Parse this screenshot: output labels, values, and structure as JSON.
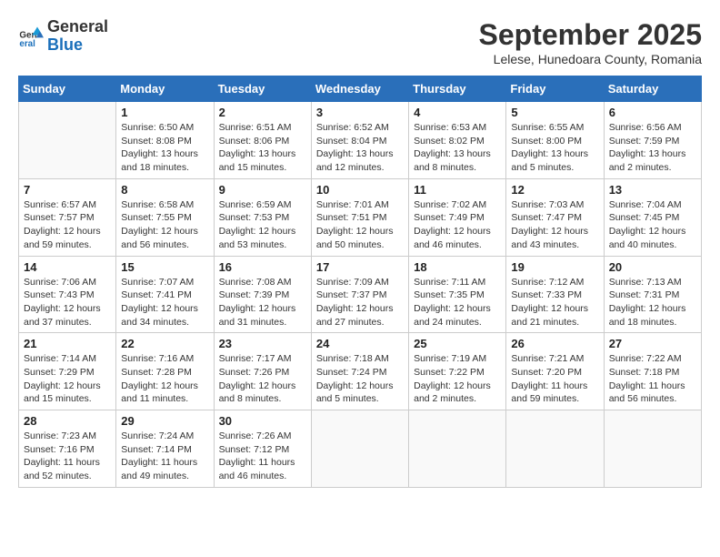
{
  "header": {
    "logo_general": "General",
    "logo_blue": "Blue",
    "month": "September 2025",
    "location": "Lelese, Hunedoara County, Romania"
  },
  "days_of_week": [
    "Sunday",
    "Monday",
    "Tuesday",
    "Wednesday",
    "Thursday",
    "Friday",
    "Saturday"
  ],
  "weeks": [
    [
      {
        "day": "",
        "info": ""
      },
      {
        "day": "1",
        "info": "Sunrise: 6:50 AM\nSunset: 8:08 PM\nDaylight: 13 hours\nand 18 minutes."
      },
      {
        "day": "2",
        "info": "Sunrise: 6:51 AM\nSunset: 8:06 PM\nDaylight: 13 hours\nand 15 minutes."
      },
      {
        "day": "3",
        "info": "Sunrise: 6:52 AM\nSunset: 8:04 PM\nDaylight: 13 hours\nand 12 minutes."
      },
      {
        "day": "4",
        "info": "Sunrise: 6:53 AM\nSunset: 8:02 PM\nDaylight: 13 hours\nand 8 minutes."
      },
      {
        "day": "5",
        "info": "Sunrise: 6:55 AM\nSunset: 8:00 PM\nDaylight: 13 hours\nand 5 minutes."
      },
      {
        "day": "6",
        "info": "Sunrise: 6:56 AM\nSunset: 7:59 PM\nDaylight: 13 hours\nand 2 minutes."
      }
    ],
    [
      {
        "day": "7",
        "info": "Sunrise: 6:57 AM\nSunset: 7:57 PM\nDaylight: 12 hours\nand 59 minutes."
      },
      {
        "day": "8",
        "info": "Sunrise: 6:58 AM\nSunset: 7:55 PM\nDaylight: 12 hours\nand 56 minutes."
      },
      {
        "day": "9",
        "info": "Sunrise: 6:59 AM\nSunset: 7:53 PM\nDaylight: 12 hours\nand 53 minutes."
      },
      {
        "day": "10",
        "info": "Sunrise: 7:01 AM\nSunset: 7:51 PM\nDaylight: 12 hours\nand 50 minutes."
      },
      {
        "day": "11",
        "info": "Sunrise: 7:02 AM\nSunset: 7:49 PM\nDaylight: 12 hours\nand 46 minutes."
      },
      {
        "day": "12",
        "info": "Sunrise: 7:03 AM\nSunset: 7:47 PM\nDaylight: 12 hours\nand 43 minutes."
      },
      {
        "day": "13",
        "info": "Sunrise: 7:04 AM\nSunset: 7:45 PM\nDaylight: 12 hours\nand 40 minutes."
      }
    ],
    [
      {
        "day": "14",
        "info": "Sunrise: 7:06 AM\nSunset: 7:43 PM\nDaylight: 12 hours\nand 37 minutes."
      },
      {
        "day": "15",
        "info": "Sunrise: 7:07 AM\nSunset: 7:41 PM\nDaylight: 12 hours\nand 34 minutes."
      },
      {
        "day": "16",
        "info": "Sunrise: 7:08 AM\nSunset: 7:39 PM\nDaylight: 12 hours\nand 31 minutes."
      },
      {
        "day": "17",
        "info": "Sunrise: 7:09 AM\nSunset: 7:37 PM\nDaylight: 12 hours\nand 27 minutes."
      },
      {
        "day": "18",
        "info": "Sunrise: 7:11 AM\nSunset: 7:35 PM\nDaylight: 12 hours\nand 24 minutes."
      },
      {
        "day": "19",
        "info": "Sunrise: 7:12 AM\nSunset: 7:33 PM\nDaylight: 12 hours\nand 21 minutes."
      },
      {
        "day": "20",
        "info": "Sunrise: 7:13 AM\nSunset: 7:31 PM\nDaylight: 12 hours\nand 18 minutes."
      }
    ],
    [
      {
        "day": "21",
        "info": "Sunrise: 7:14 AM\nSunset: 7:29 PM\nDaylight: 12 hours\nand 15 minutes."
      },
      {
        "day": "22",
        "info": "Sunrise: 7:16 AM\nSunset: 7:28 PM\nDaylight: 12 hours\nand 11 minutes."
      },
      {
        "day": "23",
        "info": "Sunrise: 7:17 AM\nSunset: 7:26 PM\nDaylight: 12 hours\nand 8 minutes."
      },
      {
        "day": "24",
        "info": "Sunrise: 7:18 AM\nSunset: 7:24 PM\nDaylight: 12 hours\nand 5 minutes."
      },
      {
        "day": "25",
        "info": "Sunrise: 7:19 AM\nSunset: 7:22 PM\nDaylight: 12 hours\nand 2 minutes."
      },
      {
        "day": "26",
        "info": "Sunrise: 7:21 AM\nSunset: 7:20 PM\nDaylight: 11 hours\nand 59 minutes."
      },
      {
        "day": "27",
        "info": "Sunrise: 7:22 AM\nSunset: 7:18 PM\nDaylight: 11 hours\nand 56 minutes."
      }
    ],
    [
      {
        "day": "28",
        "info": "Sunrise: 7:23 AM\nSunset: 7:16 PM\nDaylight: 11 hours\nand 52 minutes."
      },
      {
        "day": "29",
        "info": "Sunrise: 7:24 AM\nSunset: 7:14 PM\nDaylight: 11 hours\nand 49 minutes."
      },
      {
        "day": "30",
        "info": "Sunrise: 7:26 AM\nSunset: 7:12 PM\nDaylight: 11 hours\nand 46 minutes."
      },
      {
        "day": "",
        "info": ""
      },
      {
        "day": "",
        "info": ""
      },
      {
        "day": "",
        "info": ""
      },
      {
        "day": "",
        "info": ""
      }
    ]
  ]
}
